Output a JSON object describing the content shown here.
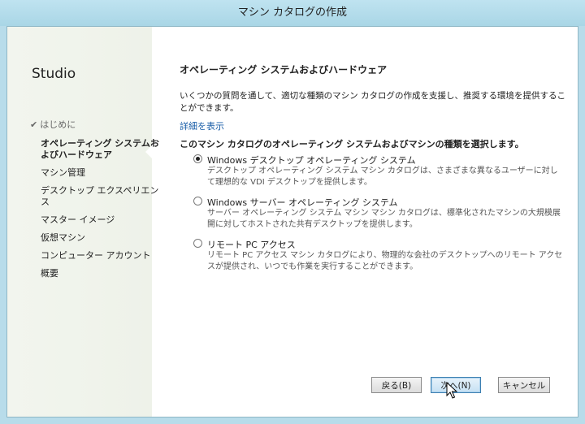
{
  "window": {
    "title": "マシン カタログの作成"
  },
  "sidebar": {
    "brand": "Studio",
    "steps": [
      {
        "label": "はじめに",
        "state": "done"
      },
      {
        "label": "オペレーティング システムおよびハードウェア",
        "state": "current"
      },
      {
        "label": "マシン管理",
        "state": "pending"
      },
      {
        "label": "デスクトップ エクスペリエンス",
        "state": "pending"
      },
      {
        "label": "マスター イメージ",
        "state": "pending"
      },
      {
        "label": "仮想マシン",
        "state": "pending"
      },
      {
        "label": "コンピューター アカウント",
        "state": "pending"
      },
      {
        "label": "概要",
        "state": "pending"
      }
    ]
  },
  "content": {
    "heading": "オペレーティング システムおよびハードウェア",
    "description": "いくつかの質問を通して、適切な種類のマシン カタログの作成を支援し、推奨する環境を提供することができます。",
    "details_link": "詳細を表示",
    "question": "このマシン カタログのオペレーティング システムおよびマシンの種類を選択します。",
    "options": [
      {
        "label": "Windows デスクトップ オペレーティング システム",
        "description": "デスクトップ オペレーティング システム マシン カタログは、さまざまな異なるユーザーに対して理想的な VDI デスクトップを提供します。",
        "selected": true
      },
      {
        "label": "Windows サーバー オペレーティング システム",
        "description": "サーバー オペレーティング システム マシン マシン カタログは、標準化されたマシンの大規模展開に対してホストされた共有デスクトップを提供します。",
        "selected": false
      },
      {
        "label": "リモート PC アクセス",
        "description": "リモート PC アクセス マシン カタログにより、物理的な会社のデスクトップへのリモート アクセスが提供され、いつでも作業を実行することができます。",
        "selected": false
      }
    ]
  },
  "buttons": {
    "back": "戻る(B)",
    "next": "次へ(N)",
    "cancel": "キャンセル"
  }
}
